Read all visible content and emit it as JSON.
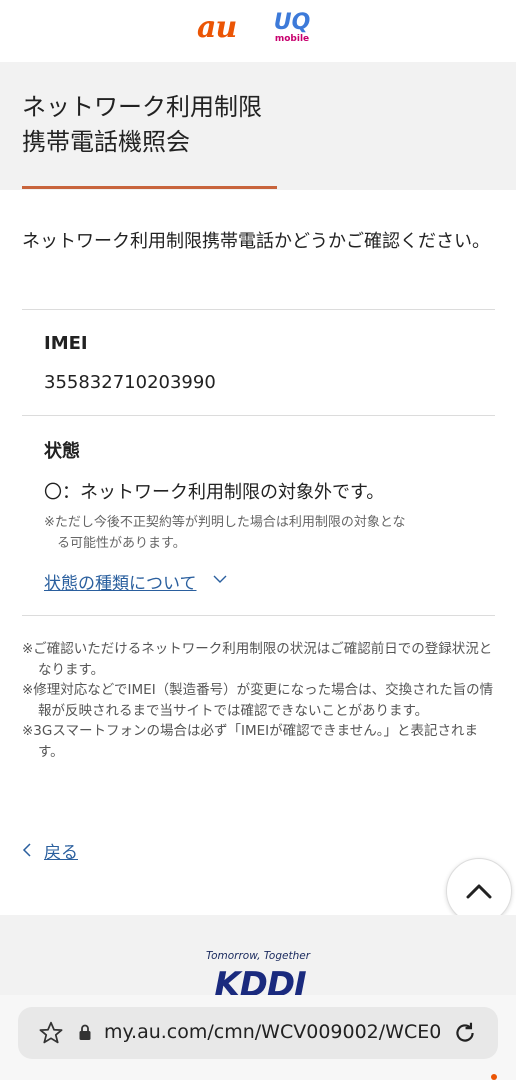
{
  "header": {
    "logo_au": "au",
    "logo_uq": "UQ",
    "logo_uq_sub": "mobile"
  },
  "page": {
    "title_line1": "ネットワーク利用制限",
    "title_line2": "携帯電話機照会",
    "intro": "ネットワーク利用制限携帯電話かどうかご確認ください。"
  },
  "imei": {
    "label": "IMEI",
    "value": "355832710203990"
  },
  "status": {
    "label": "状態",
    "text": "〇：ネットワーク利用制限の対象外です。",
    "note_line1": "※ただし今後不正契約等が判明した場合は利用制限の対象とな",
    "note_line2": "る可能性があります。",
    "link": "状態の種類について"
  },
  "notes": [
    "※ご確認いただけるネットワーク利用制限の状況はご確認前日での登録状況となります。",
    "※修理対応などでIMEI（製造番号）が変更になった場合は、交換された旨の情報が反映されるまで当サイトでは確認できないことがあります。",
    "※3Gスマートフォンの場合は必ず「IMEIが確認できません。」と表記されます。"
  ],
  "back_label": "戻る",
  "footer": {
    "tagline": "Tomorrow, Together",
    "logo": "KDDI"
  },
  "browser": {
    "url": "my.au.com/cmn/WCV009002/WCE0"
  },
  "colors": {
    "brand_orange": "#eb5505",
    "accent_underline": "#c8643c",
    "link_blue": "#2a5f9e"
  },
  "icons": {
    "link_chevron": "chevron-down-icon",
    "back_chevron": "chevron-left-icon",
    "top_button": "chevron-up-icon",
    "bookmark": "star-icon",
    "lock": "lock-icon",
    "reload": "reload-icon"
  }
}
